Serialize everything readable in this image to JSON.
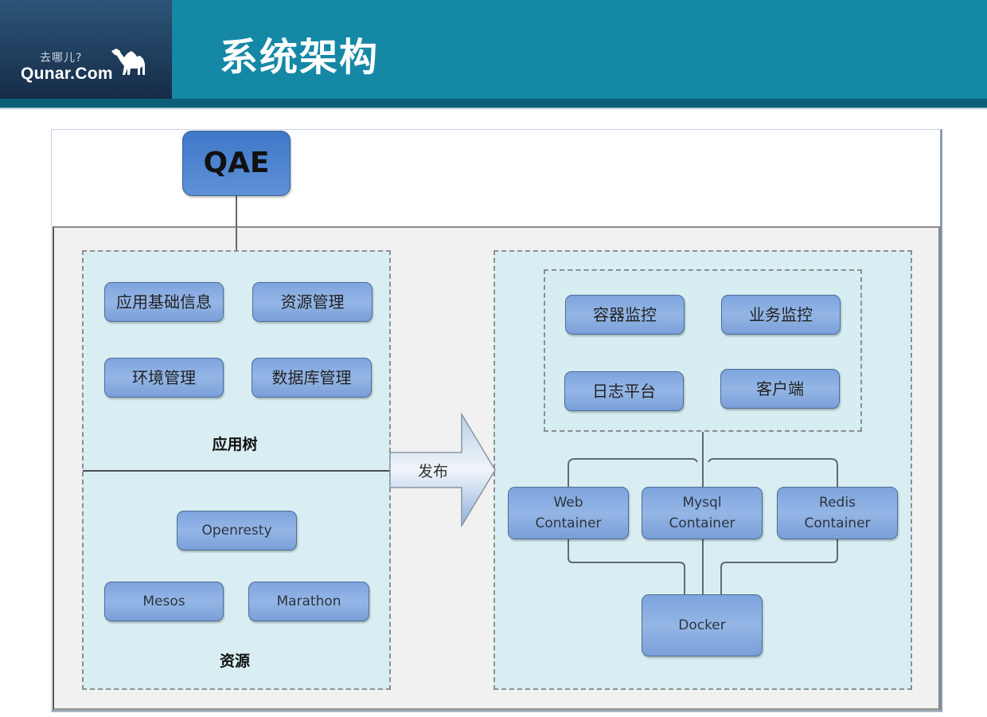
{
  "header": {
    "logo_cn": "去哪儿?",
    "logo_en": "Qunar.Com",
    "title": "系统架构",
    "colors": {
      "bar": "#1588a6",
      "strip": "#0d5f78",
      "logo_bg": "#1f3d5e"
    }
  },
  "diagram": {
    "root": {
      "label": "QAE"
    },
    "left_group": {
      "app_tree": {
        "label": "应用树",
        "items": [
          "应用基础信息",
          "资源管理",
          "环境管理",
          "数据库管理"
        ]
      },
      "resources": {
        "label": "资源",
        "items": [
          "Openresty",
          "Mesos",
          "Marathon"
        ]
      }
    },
    "publish_arrow": {
      "label": "发布"
    },
    "right_group": {
      "monitoring": {
        "items": [
          "容器监控",
          "业务监控",
          "日志平台",
          "客户端"
        ]
      },
      "containers": [
        {
          "line1": "Web",
          "line2": "Container"
        },
        {
          "line1": "Mysql",
          "line2": "Container"
        },
        {
          "line1": "Redis",
          "line2": "Container"
        }
      ],
      "engine": {
        "label": "Docker"
      }
    },
    "colors": {
      "node_fill": "#8eb0e4",
      "node_border": "#4d6e94",
      "group_fill": "#d9eef3",
      "root_fill": "#4a80cc"
    }
  }
}
